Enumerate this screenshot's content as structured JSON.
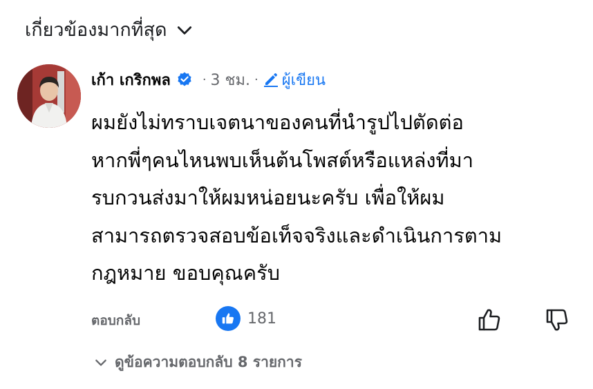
{
  "sort": {
    "label": "เกี่ยวข้องมากที่สุด",
    "icon": "chevron-down-icon"
  },
  "comment": {
    "author": "เก้า เกริกพล",
    "verified_icon": "verified-badge-icon",
    "separator": "·",
    "time": "3 ชม.",
    "author_badge_icon": "pen-icon",
    "author_badge": "ผู้เขียน",
    "text": "ผมยังไม่ทราบเจตนาของคนที่นำรูปไปตัดต่อ\nหากพี่ๆคนไหนพบเห็นต้นโพสต์หรือแหล่งที่มา\nรบกวนส่งมาให้ผมหน่อยนะครับ เพื่อให้ผม\nสามารถตรวจสอบข้อเท็จจริงและดำเนินการตาม\nกฎหมาย ขอบคุณครับ"
  },
  "actions": {
    "reply_label": "ตอบกลับ",
    "like_count": "181",
    "like_icon": "like-reaction-icon",
    "thumb_up_icon": "thumbs-up-icon",
    "thumb_down_icon": "thumbs-down-icon"
  },
  "replies": {
    "label": "ดูข้อความตอบกลับ 8 รายการ",
    "icon": "chevron-down-icon"
  },
  "colors": {
    "accent": "#1877f2",
    "secondary_text": "#65676b",
    "primary_text": "#050505"
  }
}
